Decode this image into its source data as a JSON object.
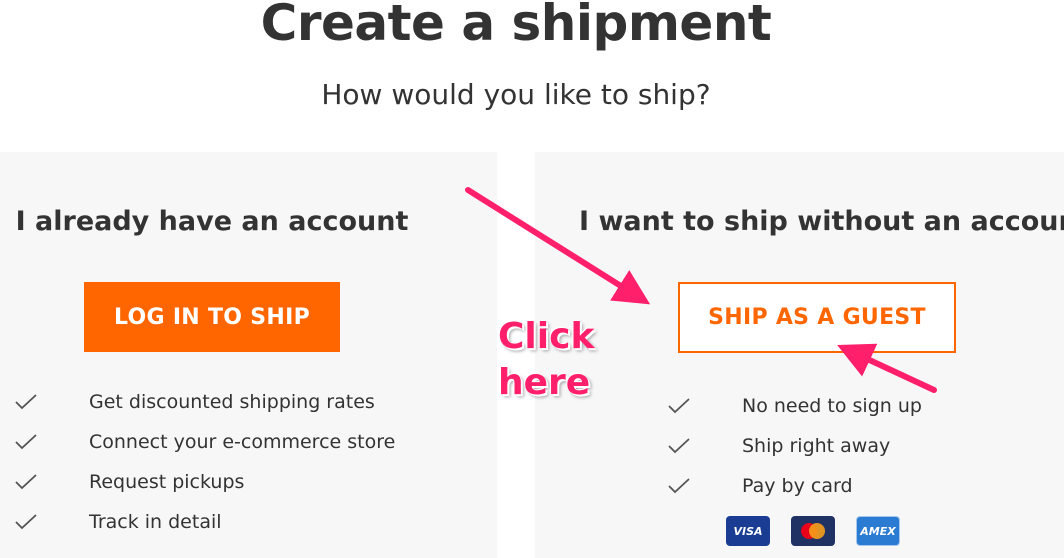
{
  "header": {
    "title": "Create a shipment",
    "subtitle": "How would you like to ship?"
  },
  "account_card": {
    "title": "I already have an account",
    "button_label": "LOG IN TO SHIP",
    "features": [
      "Get discounted shipping rates",
      "Connect your e-commerce store",
      "Request pickups",
      "Track in detail"
    ]
  },
  "guest_card": {
    "title": "I want to ship without an account",
    "button_label": "SHIP AS A GUEST",
    "features": [
      "No need to sign up",
      "Ship right away",
      "Pay by card"
    ],
    "payment_methods": [
      "VISA",
      "Mastercard",
      "AMEX"
    ]
  },
  "annotation": {
    "line1": "Click",
    "line2": "here"
  },
  "colors": {
    "accent": "#ff6600",
    "annotation": "#ff1f6b",
    "card_bg": "#f7f7f7",
    "text": "#333333"
  }
}
